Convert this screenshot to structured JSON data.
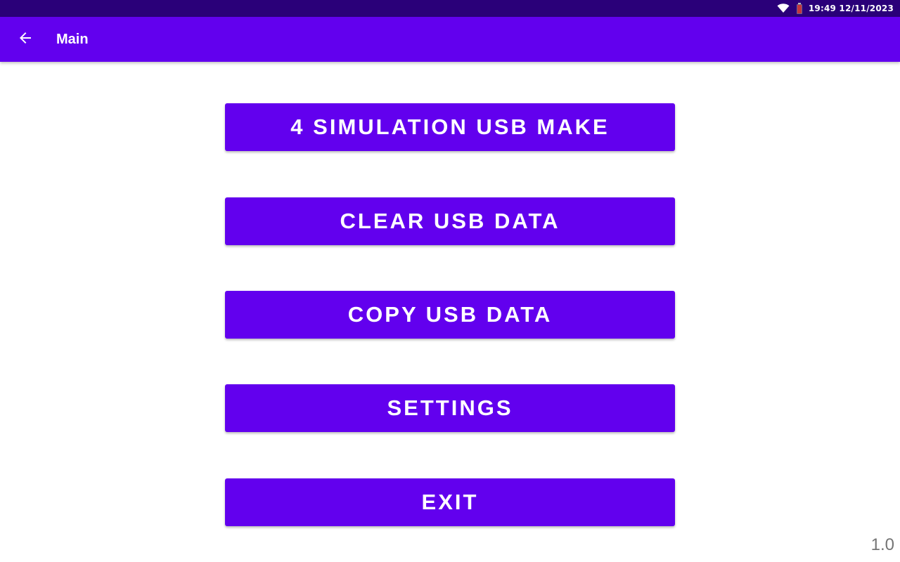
{
  "status_bar": {
    "icons": [
      "wifi-icon",
      "battery-icon"
    ],
    "clock": "19:49 12/11/2023"
  },
  "app_bar": {
    "back_icon": "arrow-left-icon",
    "title": "Main"
  },
  "buttons": [
    "4 SIMULATION USB MAKE",
    "CLEAR USB DATA",
    "COPY USB DATA",
    "SETTINGS",
    "EXIT"
  ],
  "version": "1.0",
  "colors": {
    "status_bar": "#2a0079",
    "primary": "#6200ee",
    "on_primary": "#ffffff",
    "battery": "#d32f2f",
    "version_text": "#757575"
  }
}
